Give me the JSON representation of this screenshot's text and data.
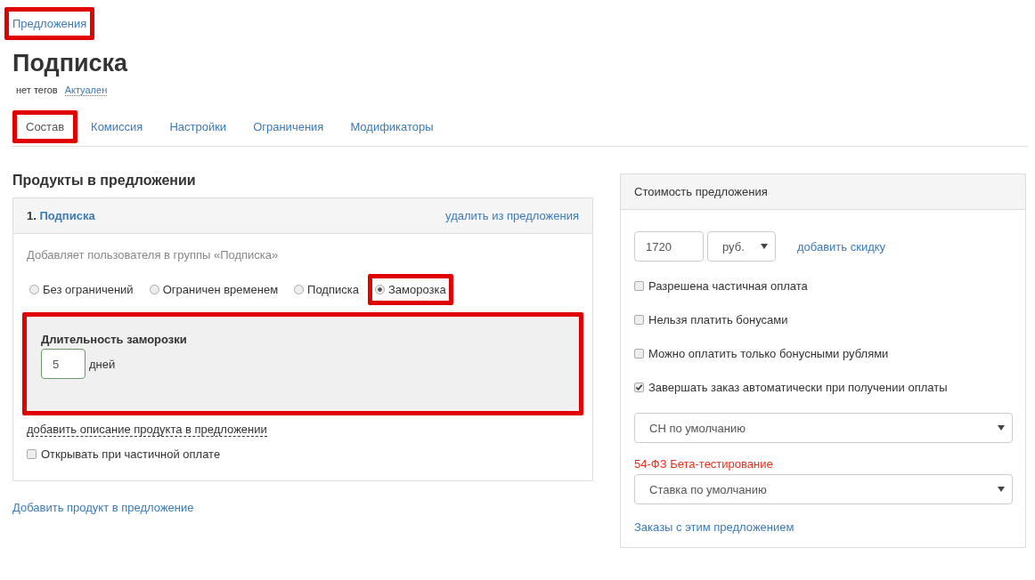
{
  "breadcrumb": {
    "label": "Предложения",
    "highlighted": true
  },
  "title": "Подписка",
  "meta": {
    "tags": "нет тегов",
    "status": "Актуален"
  },
  "tabs": [
    {
      "label": "Состав",
      "selected": true,
      "highlighted": true
    },
    {
      "label": "Комиссия",
      "selected": false,
      "highlighted": false
    },
    {
      "label": "Настройки",
      "selected": false,
      "highlighted": false
    },
    {
      "label": "Ограничения",
      "selected": false,
      "highlighted": false
    },
    {
      "label": "Модификаторы",
      "selected": false,
      "highlighted": false
    }
  ],
  "products": {
    "heading": "Продукты в предложении",
    "items": [
      {
        "number": "1.",
        "name": "Подписка",
        "remove": "удалить из предложения",
        "description": "Добавляет пользователя в группы «Подписка»",
        "access_options": [
          {
            "label": "Без ограничений",
            "selected": false,
            "highlighted": false
          },
          {
            "label": "Ограничен временем",
            "selected": false,
            "highlighted": false
          },
          {
            "label": "Подписка",
            "selected": false,
            "highlighted": false
          },
          {
            "label": "Заморозка",
            "selected": true,
            "highlighted": true
          }
        ],
        "freeze": {
          "label": "Длительность заморозки",
          "value": "5",
          "unit": "дней",
          "highlighted": true
        },
        "add_description": "добавить описание продукта в предложении",
        "open_on_partial": {
          "label": "Открывать при частичной оплате",
          "checked": false
        }
      }
    ],
    "add_product": "Добавить продукт в предложение"
  },
  "price": {
    "heading": "Стоимость предложения",
    "amount": "1720",
    "currency": "руб.",
    "add_discount": "добавить скидку",
    "options": [
      {
        "label": "Разрешена частичная оплата",
        "checked": false
      },
      {
        "label": "Нельзя платить бонусами",
        "checked": false
      },
      {
        "label": "Можно оплатить только бонусными рублями",
        "checked": false
      },
      {
        "label": "Завершать заказ автоматически при получении оплаты",
        "checked": true
      }
    ],
    "tax_system": "СН по умолчанию",
    "beta_label": "54-ФЗ Бета-тестирование",
    "vat_rate": "Ставка по умолчанию",
    "orders_link": "Заказы с этим предложением"
  }
}
